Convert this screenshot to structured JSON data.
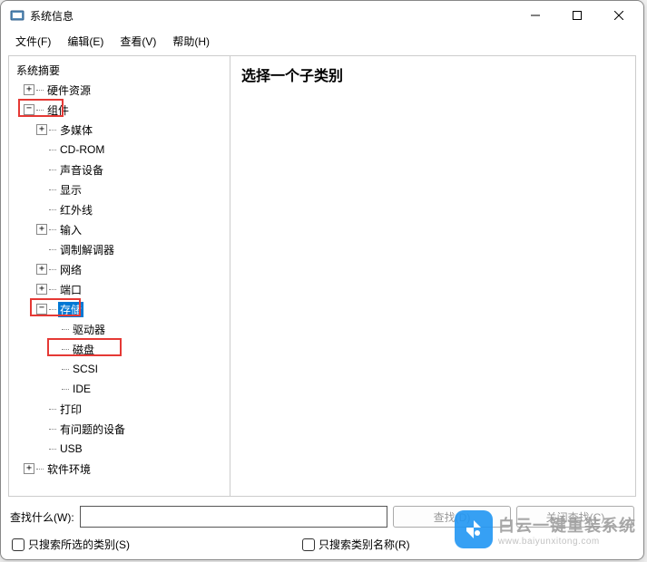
{
  "window": {
    "title": "系统信息"
  },
  "menubar": {
    "file": "文件(F)",
    "edit": "编辑(E)",
    "view": "查看(V)",
    "help": "帮助(H)"
  },
  "tree": {
    "summary": "系统摘要",
    "hardware": "硬件资源",
    "components": "组件",
    "multimedia": "多媒体",
    "cdrom": "CD-ROM",
    "sound": "声音设备",
    "display": "显示",
    "infrared": "红外线",
    "input": "输入",
    "modem": "调制解调器",
    "network": "网络",
    "ports": "端口",
    "storage": "存储",
    "drives": "驱动器",
    "disks": "磁盘",
    "scsi": "SCSI",
    "ide": "IDE",
    "printing": "打印",
    "problem": "有问题的设备",
    "usb": "USB",
    "software": "软件环境"
  },
  "detail": {
    "heading": "选择一个子类别"
  },
  "search": {
    "label": "查找什么(W):",
    "placeholder": "",
    "find_btn": "查找(D)",
    "close_btn": "关闭查找(C)",
    "only_selected": "只搜索所选的类别(S)",
    "only_names": "只搜索类别名称(R)"
  },
  "watermark": {
    "main": "白云一键重装系统",
    "sub": "www.baiyunxitong.com"
  }
}
